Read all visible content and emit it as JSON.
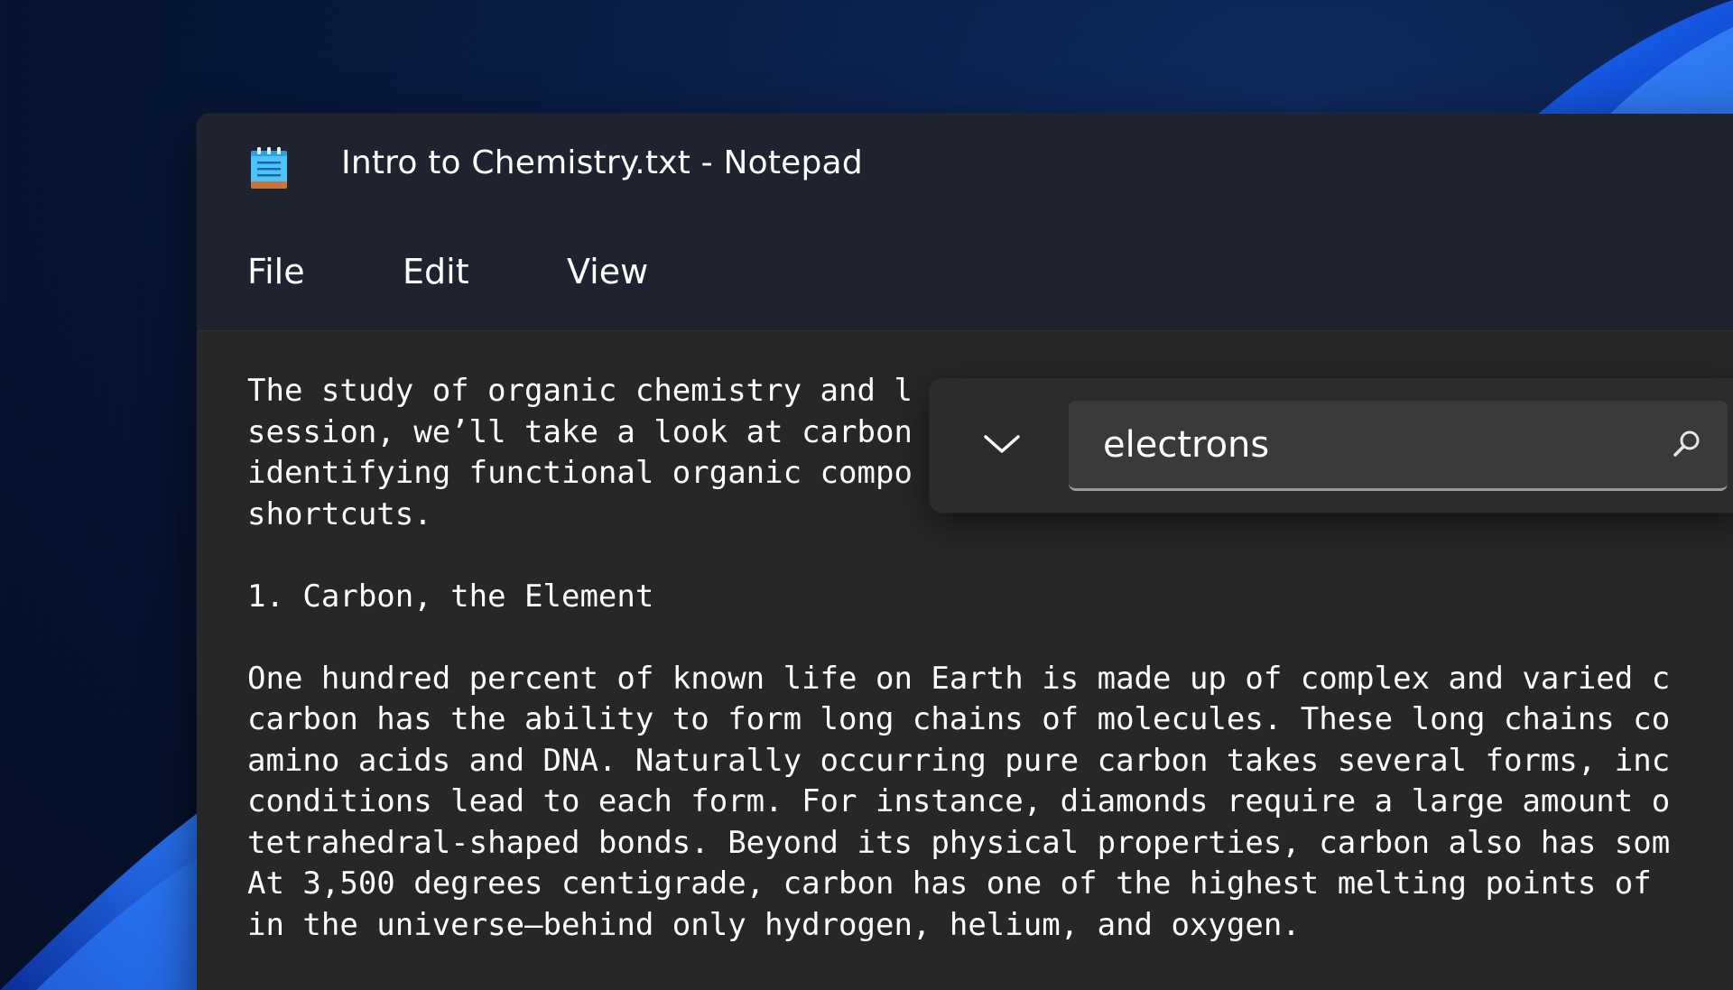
{
  "window": {
    "title": "Intro to Chemistry.txt - Notepad",
    "app_icon": "notepad-icon"
  },
  "menu": {
    "items": [
      {
        "label": "File"
      },
      {
        "label": "Edit"
      },
      {
        "label": "View"
      }
    ]
  },
  "editor": {
    "content": "The study of organic chemistry and l\nsession, we’ll take a look at carbon\nidentifying functional organic compo\nshortcuts.\n\n1. Carbon, the Element\n\nOne hundred percent of known life on Earth is made up of complex and varied c\ncarbon has the ability to form long chains of molecules. These long chains co\namino acids and DNA. Naturally occurring pure carbon takes several forms, inc\nconditions lead to each form. For instance, diamonds require a large amount o\ntetrahedral-shaped bonds. Beyond its physical properties, carbon also has som\nAt 3,500 degrees centigrade, carbon has one of the highest melting points of\nin the universe—behind only hydrogen, helium, and oxygen."
  },
  "find": {
    "query": "electrons",
    "toggle_icon": "chevron-down-icon",
    "search_icon": "search-icon"
  },
  "colors": {
    "titlebar_bg": "#1f2330",
    "editor_bg": "#272727",
    "find_panel_bg": "#2c2c2c",
    "find_input_bg": "#3a3a3a",
    "text": "#ffffff",
    "icon_blue": "#4cc2ff"
  }
}
